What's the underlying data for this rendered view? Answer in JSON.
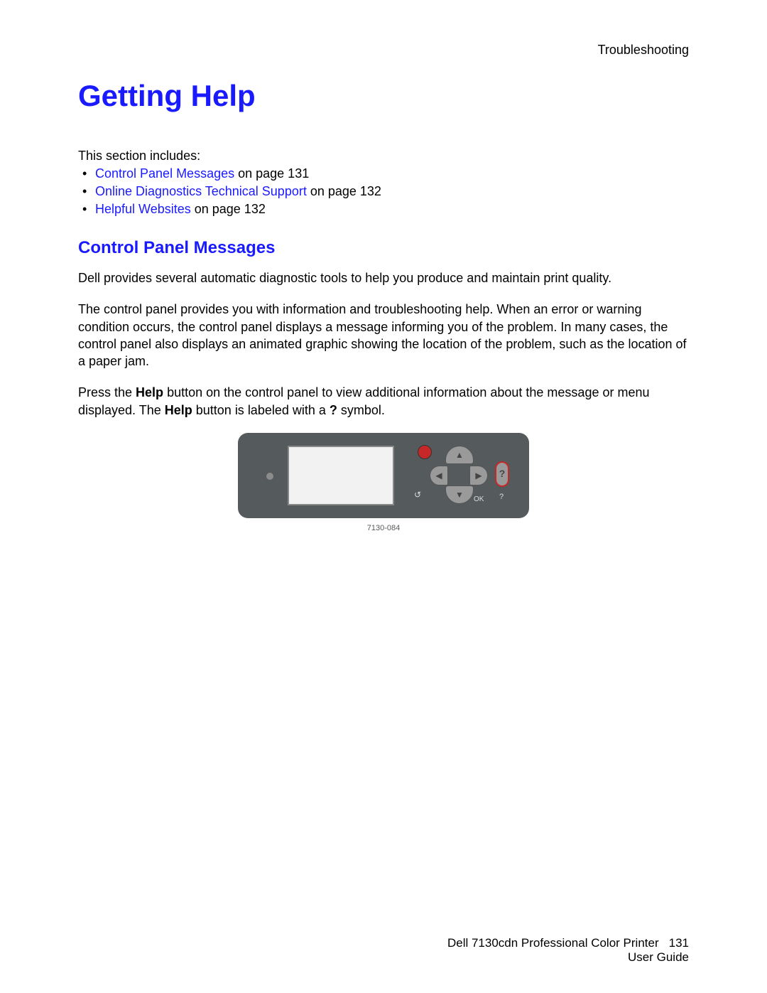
{
  "header": {
    "section": "Troubleshooting"
  },
  "title": "Getting Help",
  "intro": "This section includes:",
  "links": [
    {
      "text": "Control Panel Messages",
      "suffix": " on page 131"
    },
    {
      "text": "Online Diagnostics Technical Support",
      "suffix": " on page 132"
    },
    {
      "text": "Helpful Websites",
      "suffix": " on page 132"
    }
  ],
  "subtitle": "Control Panel Messages",
  "paragraphs": {
    "p1": "Dell provides several automatic diagnostic tools to help you produce and maintain print quality.",
    "p2": "The control panel provides you with information and troubleshooting help. When an error or warning condition occurs, the control panel displays a message informing you of the problem. In many cases, the control panel also displays an animated graphic showing the location of the problem, such as the location of a paper jam.",
    "p3a": "Press the ",
    "p3b": "Help",
    "p3c": " button on the control panel to view additional information about the message or menu displayed. The ",
    "p3d": "Help",
    "p3e": " button is labeled with a ",
    "p3f": "?",
    "p3g": " symbol."
  },
  "panel": {
    "ok_label": "OK",
    "back_glyph": "↺",
    "up_glyph": "▲",
    "down_glyph": "▼",
    "left_glyph": "◀",
    "right_glyph": "▶",
    "help_glyph": "?",
    "help_label": "?"
  },
  "figure_id": "7130-084",
  "footer": {
    "product": "Dell 7130cdn Professional Color Printer",
    "page_number": "131",
    "doc": "User Guide"
  }
}
